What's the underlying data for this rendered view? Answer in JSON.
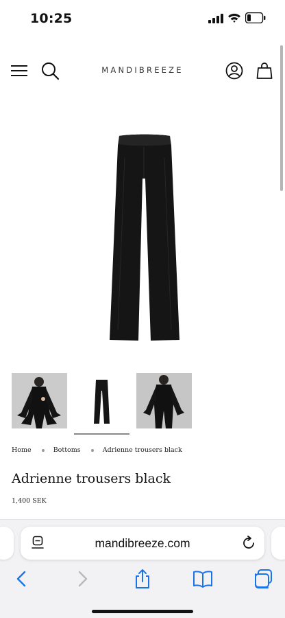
{
  "status_bar": {
    "time": "10:25",
    "icons": [
      "cellular-signal-icon",
      "wifi-icon",
      "battery-icon"
    ],
    "battery_level": 0.25
  },
  "header": {
    "logo": "MANDIBREEZE",
    "icons": [
      "menu-icon",
      "search-icon",
      "account-icon",
      "bag-icon"
    ]
  },
  "product": {
    "main_image": "black-trousers-image",
    "thumbnails": [
      "model-front-view",
      "trousers-flat-view",
      "model-back-view"
    ],
    "selected_thumbnail": 1,
    "breadcrumb": [
      "Home",
      "Bottoms",
      "Adrienne trousers black"
    ],
    "title": "Adrienne trousers black",
    "price": "1,400 SEK"
  },
  "browser": {
    "url": "mandibreeze.com",
    "toolbar": [
      "back-icon",
      "forward-icon",
      "share-icon",
      "bookmarks-icon",
      "tabs-icon"
    ]
  },
  "colors": {
    "text": "#111111",
    "accent_blue": "#1a73e8",
    "disabled": "#b9b9bd",
    "chrome_bg": "#f2f2f4"
  }
}
